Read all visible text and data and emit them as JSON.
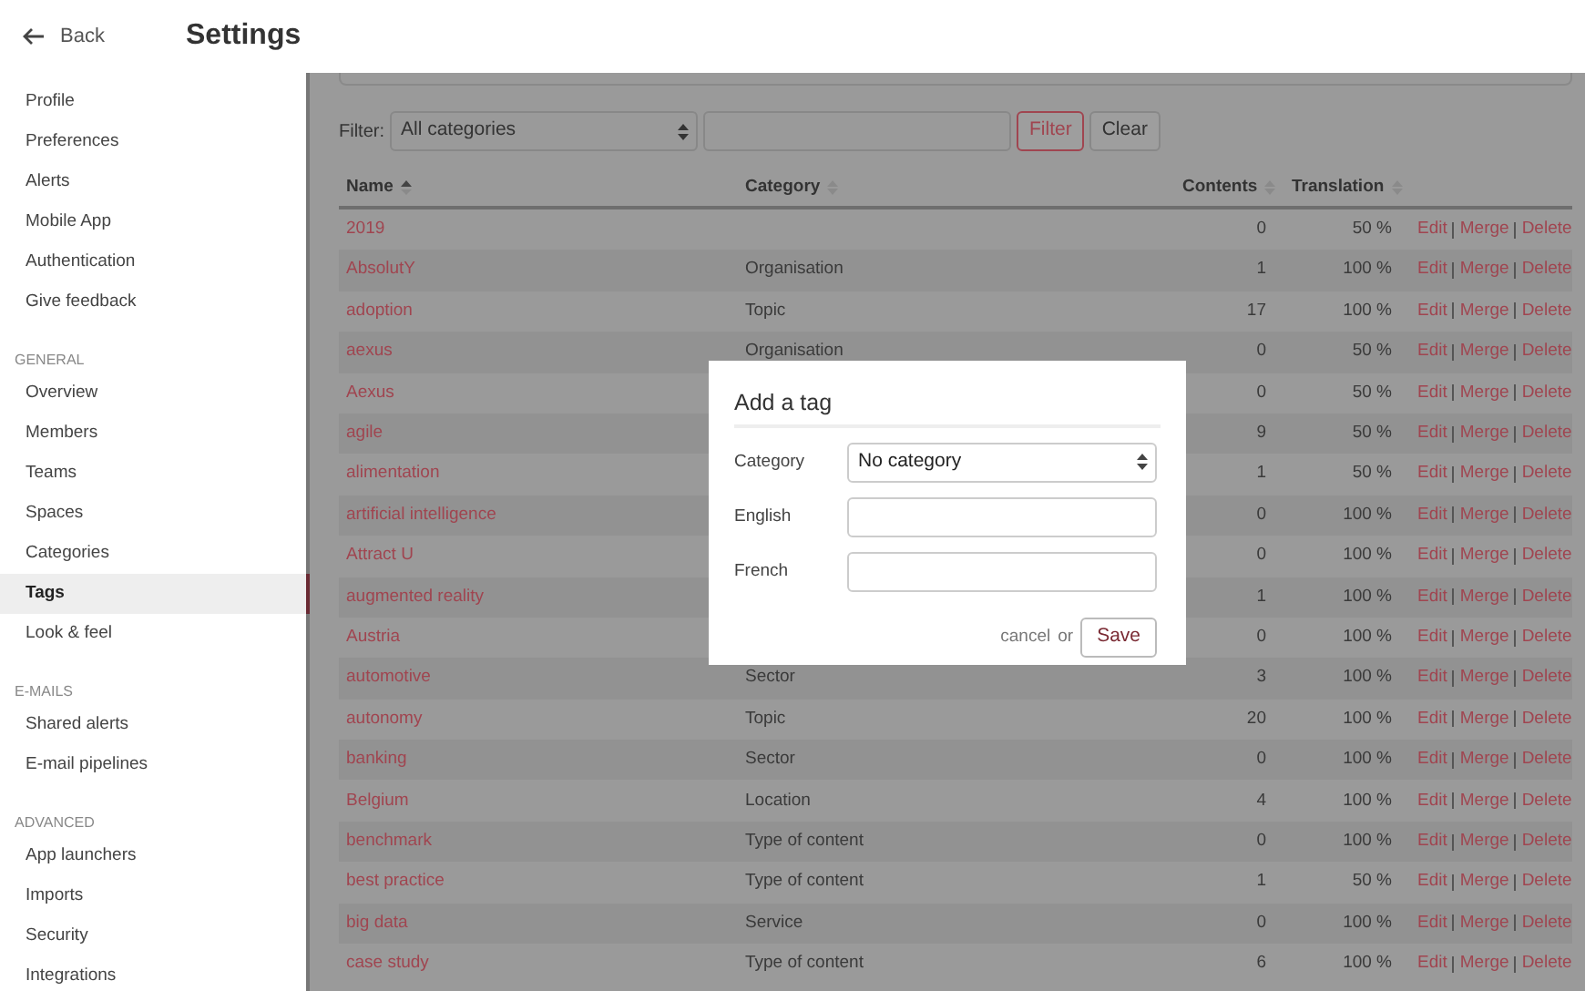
{
  "header": {
    "back_label": "Back",
    "title": "Settings"
  },
  "sidebar": {
    "sections": [
      {
        "items": [
          {
            "label": "Profile",
            "selected": false
          },
          {
            "label": "Preferences",
            "selected": false
          },
          {
            "label": "Alerts",
            "selected": false
          },
          {
            "label": "Mobile App",
            "selected": false
          },
          {
            "label": "Authentication",
            "selected": false
          },
          {
            "label": "Give feedback",
            "selected": false
          }
        ]
      },
      {
        "heading": "GENERAL",
        "items": [
          {
            "label": "Overview",
            "selected": false
          },
          {
            "label": "Members",
            "selected": false
          },
          {
            "label": "Teams",
            "selected": false
          },
          {
            "label": "Spaces",
            "selected": false
          },
          {
            "label": "Categories",
            "selected": false
          },
          {
            "label": "Tags",
            "selected": true
          },
          {
            "label": "Look & feel",
            "selected": false
          }
        ]
      },
      {
        "heading": "E-MAILS",
        "items": [
          {
            "label": "Shared alerts",
            "selected": false
          },
          {
            "label": "E-mail pipelines",
            "selected": false
          }
        ]
      },
      {
        "heading": "ADVANCED",
        "items": [
          {
            "label": "App launchers",
            "selected": false
          },
          {
            "label": "Imports",
            "selected": false
          },
          {
            "label": "Security",
            "selected": false
          },
          {
            "label": "Integrations",
            "selected": false
          }
        ]
      }
    ]
  },
  "filter": {
    "label": "Filter:",
    "category": "All categories",
    "buttons": [
      {
        "label": "Filter",
        "kind": "primary"
      },
      {
        "label": "Clear",
        "kind": "plain"
      }
    ]
  },
  "table": {
    "columns": [
      {
        "label": "Name",
        "sorted": true
      },
      {
        "label": "Category",
        "sorted": false
      },
      {
        "label": "Contents",
        "sorted": false
      },
      {
        "label": "Translation",
        "sorted": false
      }
    ],
    "rows": [
      {
        "name": "2019",
        "contents": "0",
        "translation": "50 %",
        "actions": [
          "Edit",
          "Merge",
          "Delete"
        ]
      },
      {
        "name": "AbsolutY",
        "category": "Organisation",
        "contents": "1",
        "translation": "100 %",
        "actions": [
          "Edit",
          "Merge",
          "Delete"
        ]
      },
      {
        "name": "adoption",
        "category": "Topic",
        "contents": "17",
        "translation": "100 %",
        "actions": [
          "Edit",
          "Merge",
          "Delete"
        ]
      },
      {
        "name": "aexus",
        "category": "Organisation",
        "contents": "0",
        "translation": "50 %",
        "actions": [
          "Edit",
          "Merge",
          "Delete"
        ]
      },
      {
        "name": "Aexus",
        "contents": "0",
        "translation": "50 %",
        "actions": [
          "Edit",
          "Merge",
          "Delete"
        ]
      },
      {
        "name": "agile",
        "contents": "9",
        "translation": "50 %",
        "actions": [
          "Edit",
          "Merge",
          "Delete"
        ]
      },
      {
        "name": "alimentation",
        "contents": "1",
        "translation": "50 %",
        "actions": [
          "Edit",
          "Merge",
          "Delete"
        ]
      },
      {
        "name": "artificial intelligence",
        "contents": "0",
        "translation": "100 %",
        "actions": [
          "Edit",
          "Merge",
          "Delete"
        ]
      },
      {
        "name": "Attract U",
        "contents": "0",
        "translation": "100 %",
        "actions": [
          "Edit",
          "Merge",
          "Delete"
        ]
      },
      {
        "name": "augmented reality",
        "contents": "1",
        "translation": "100 %",
        "actions": [
          "Edit",
          "Merge",
          "Delete"
        ]
      },
      {
        "name": "Austria",
        "contents": "0",
        "translation": "100 %",
        "actions": [
          "Edit",
          "Merge",
          "Delete"
        ]
      },
      {
        "name": "automotive",
        "category": "Sector",
        "contents": "3",
        "translation": "100 %",
        "actions": [
          "Edit",
          "Merge",
          "Delete"
        ]
      },
      {
        "name": "autonomy",
        "category": "Topic",
        "contents": "20",
        "translation": "100 %",
        "actions": [
          "Edit",
          "Merge",
          "Delete"
        ]
      },
      {
        "name": "banking",
        "category": "Sector",
        "contents": "0",
        "translation": "100 %",
        "actions": [
          "Edit",
          "Merge",
          "Delete"
        ]
      },
      {
        "name": "Belgium",
        "category": "Location",
        "contents": "4",
        "translation": "100 %",
        "actions": [
          "Edit",
          "Merge",
          "Delete"
        ]
      },
      {
        "name": "benchmark",
        "category": "Type of content",
        "contents": "0",
        "translation": "100 %",
        "actions": [
          "Edit",
          "Merge",
          "Delete"
        ]
      },
      {
        "name": "best practice",
        "category": "Type of content",
        "contents": "1",
        "translation": "50 %",
        "actions": [
          "Edit",
          "Merge",
          "Delete"
        ]
      },
      {
        "name": "big data",
        "category": "Service",
        "contents": "0",
        "translation": "100 %",
        "actions": [
          "Edit",
          "Merge",
          "Delete"
        ]
      },
      {
        "name": "case study",
        "category": "Type of content",
        "contents": "6",
        "translation": "100 %",
        "actions": [
          "Edit",
          "Merge",
          "Delete"
        ]
      }
    ]
  },
  "modal": {
    "title": "Add a tag",
    "fields": [
      {
        "label": "Category",
        "kind": "select",
        "value": "No category"
      },
      {
        "label": "English",
        "kind": "text"
      },
      {
        "label": "French",
        "kind": "text"
      }
    ],
    "cancel": "cancel",
    "or": "or",
    "save": "Save"
  }
}
